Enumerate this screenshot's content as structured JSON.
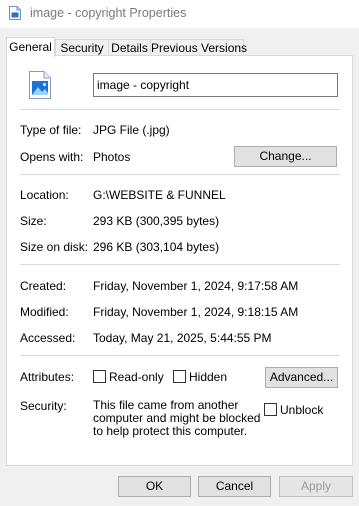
{
  "window": {
    "title": "image - copyright Properties",
    "icon": "document-icon"
  },
  "tabs": [
    {
      "label": "General",
      "active": true
    },
    {
      "label": "Security",
      "active": false
    },
    {
      "label": "Details",
      "active": false
    },
    {
      "label": "Previous Versions",
      "active": false
    }
  ],
  "general": {
    "file_icon": "image-file-icon",
    "file_name": "image - copyright",
    "type_label": "Type of file:",
    "type_value": "JPG File (.jpg)",
    "opens_label": "Opens with:",
    "opens_value": "Photos",
    "change_button": "Change...",
    "location_label": "Location:",
    "location_value": "G:\\WEBSITE & FUNNEL",
    "size_label": "Size:",
    "size_value": "293 KB (300,395 bytes)",
    "size_on_disk_label": "Size on disk:",
    "size_on_disk_value": "296 KB (303,104 bytes)",
    "created_label": "Created:",
    "created_value": "Friday, November 1, 2024, 9:17:58 AM",
    "modified_label": "Modified:",
    "modified_value": "Friday, November 1, 2024, 9:18:15 AM",
    "accessed_label": "Accessed:",
    "accessed_value": "Today, May 21, 2025, 5:44:55 PM",
    "attributes_label": "Attributes:",
    "readonly_label": "Read-only",
    "readonly_checked": false,
    "hidden_label": "Hidden",
    "hidden_checked": false,
    "advanced_button": "Advanced...",
    "security_label": "Security:",
    "security_text": "This file came from another computer and might be blocked to help protect this computer.",
    "unblock_label": "Unblock",
    "unblock_checked": false
  },
  "footer": {
    "ok": "OK",
    "cancel": "Cancel",
    "apply": "Apply",
    "apply_enabled": false
  }
}
